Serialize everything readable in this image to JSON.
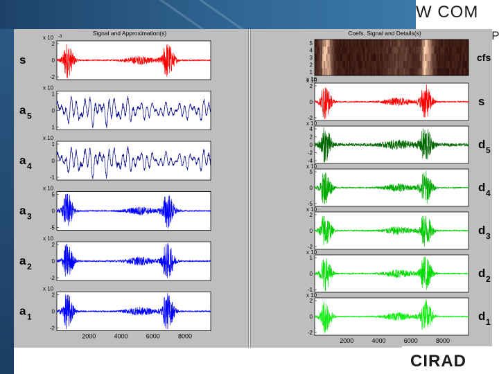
{
  "left_panel": {
    "title": "Signal and Approximation(s)",
    "rows": [
      {
        "label": "s",
        "sub": "",
        "exp": "x 10",
        "exp_power": "-3",
        "yticks": [
          "2",
          "0",
          "-2"
        ],
        "color": "#ff0000"
      },
      {
        "label": "a",
        "sub": "5",
        "exp": "x 10",
        "exp_power": "",
        "yticks": [
          "1",
          "0",
          "1"
        ],
        "color": "#000088"
      },
      {
        "label": "a",
        "sub": "4",
        "exp": "x 10",
        "exp_power": "",
        "yticks": [
          "1",
          "0",
          "-1"
        ],
        "color": "#000088"
      },
      {
        "label": "a",
        "sub": "3",
        "exp": "x 10",
        "exp_power": "",
        "yticks": [
          "5",
          "0",
          "-5"
        ],
        "color": "#0000ff"
      },
      {
        "label": "a",
        "sub": "2",
        "exp": "x 10",
        "exp_power": "",
        "yticks": [
          "2",
          "0",
          "-2"
        ],
        "color": "#0000ff"
      },
      {
        "label": "a",
        "sub": "1",
        "exp": "x 10",
        "exp_power": "",
        "yticks": [
          "2",
          "0",
          "-2"
        ],
        "color": "#0000ff"
      }
    ],
    "xticks": [
      "2000",
      "4000",
      "6000",
      "8000"
    ]
  },
  "right_panel": {
    "title": "Coefs, Signal and Details(s)",
    "cfs": {
      "label": "cfs",
      "yticks": [
        "5",
        "4",
        "3",
        "2",
        "1"
      ],
      "exp": "x 10"
    },
    "rows": [
      {
        "label": "s",
        "sub": "",
        "exp": "x 10",
        "yticks": [
          "2",
          "0",
          "-2"
        ],
        "color": "#ff0000"
      },
      {
        "label": "d",
        "sub": "5",
        "exp": "x 10",
        "yticks": [
          "4",
          "2",
          "0",
          "-2",
          "-4"
        ],
        "color": "#006600"
      },
      {
        "label": "d",
        "sub": "4",
        "exp": "x 10",
        "yticks": [
          "5",
          "0",
          "-5"
        ],
        "color": "#00aa00"
      },
      {
        "label": "d",
        "sub": "3",
        "exp": "x 10",
        "yticks": [
          "2",
          "0",
          "-2"
        ],
        "color": "#00cc00"
      },
      {
        "label": "d",
        "sub": "2",
        "exp": "x 10",
        "yticks": [
          "1",
          "0",
          "-1"
        ],
        "color": "#00dd00"
      },
      {
        "label": "d",
        "sub": "1",
        "exp": "x 10",
        "yticks": [
          "2",
          "0",
          "-2"
        ],
        "color": "#11ee11"
      }
    ],
    "xticks": [
      "2000",
      "4000",
      "6000",
      "8000"
    ]
  },
  "branding": {
    "top": "W COM",
    "top_suffix": "UP",
    "bottom": "CIRAD"
  },
  "chart_data": {
    "type": "line",
    "xlim": [
      0,
      9600
    ],
    "colors": {
      "signal": "#ff0000",
      "approx": "#0000ff",
      "detail": "#00cc00",
      "cfs_dark": "#3a0a05",
      "cfs_light": "#ffe6c8"
    },
    "bursts": [
      {
        "center": 650,
        "spread": 350
      },
      {
        "center": 6900,
        "spread": 380
      }
    ],
    "secondary_burst": {
      "center": 5200,
      "spread": 900
    }
  }
}
